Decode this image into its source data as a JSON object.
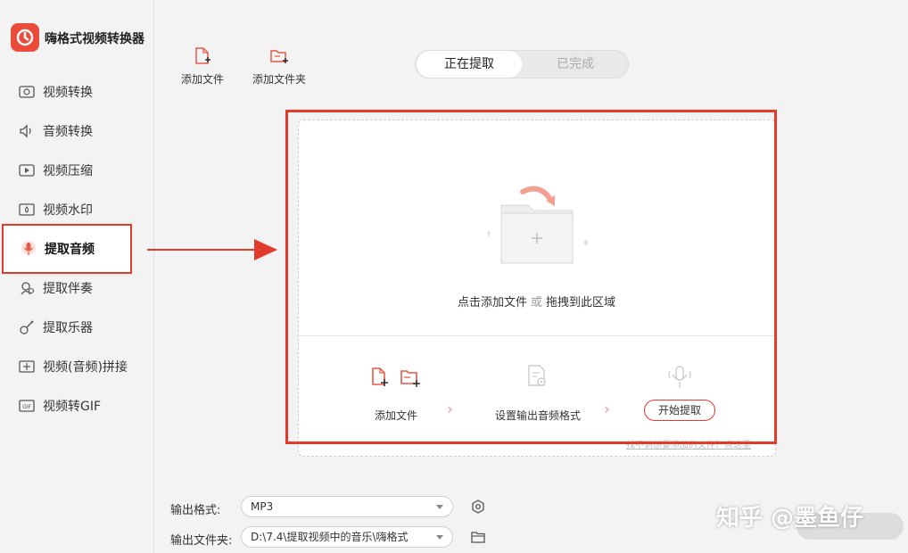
{
  "app": {
    "title": "嗨格式视频转换器"
  },
  "sidebar": {
    "items": [
      {
        "label": "视频转换",
        "icon": "video-convert-icon"
      },
      {
        "label": "音频转换",
        "icon": "audio-convert-icon"
      },
      {
        "label": "视频压缩",
        "icon": "video-compress-icon"
      },
      {
        "label": "视频水印",
        "icon": "video-watermark-icon"
      },
      {
        "label": "提取音频",
        "icon": "extract-audio-icon",
        "active": true
      },
      {
        "label": "提取伴奏",
        "icon": "extract-accompaniment-icon"
      },
      {
        "label": "提取乐器",
        "icon": "guitar-icon"
      },
      {
        "label": "视频(音频)拼接",
        "icon": "merge-icon"
      },
      {
        "label": "视频转GIF",
        "icon": "gif-icon"
      }
    ]
  },
  "toolbar": {
    "add_file": "添加文件",
    "add_folder": "添加文件夹"
  },
  "tabs": {
    "in_progress": "正在提取",
    "done": "已完成"
  },
  "dropzone": {
    "click_add": "点击添加文件",
    "or": "或",
    "drag_here": "拖拽到此区域",
    "step1": "添加文件",
    "step2": "设置输出音频格式",
    "start": "开始提取",
    "hint": "找不到想要添加的文件？点这里"
  },
  "output": {
    "format_label": "输出格式:",
    "format_value": "MP3",
    "folder_label": "输出文件夹:",
    "folder_value": "D:\\7.4\\提取视频中的音乐\\嗨格式"
  },
  "watermark": "知乎 @墨鱼仔",
  "colors": {
    "accent": "#e23a2b",
    "brand": "#ea4b3a"
  }
}
